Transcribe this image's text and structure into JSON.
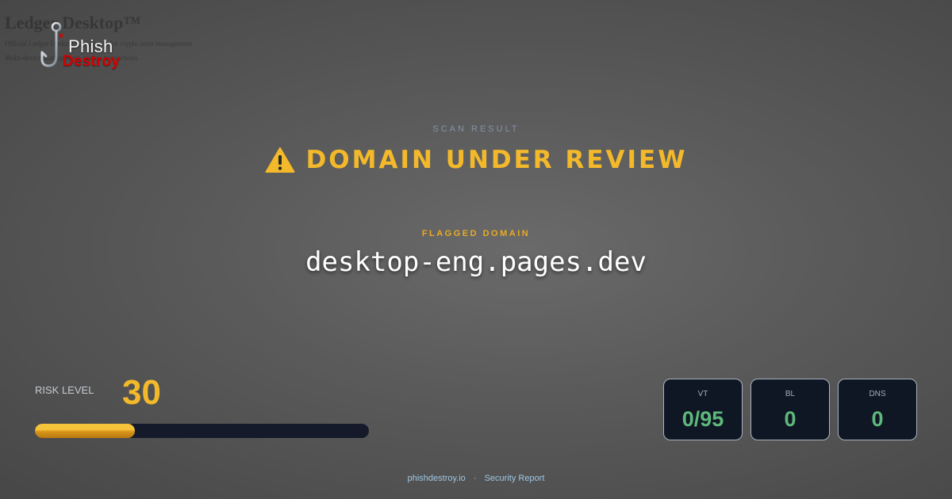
{
  "background_page": {
    "title": "Ledger Desktop™",
    "line1": "Official Ledger Desktop application for crypto asset management",
    "line2": "Multi-device management, secure transactions"
  },
  "logo": {
    "word1": "Phish",
    "word2": "Destroy",
    "icon": "fish-hook-icon"
  },
  "scan": {
    "label": "SCAN RESULT",
    "status_icon": "warning-triangle-icon",
    "status_text": "DOMAIN UNDER REVIEW"
  },
  "flagged": {
    "label": "FLAGGED DOMAIN",
    "domain": "desktop-eng.pages.dev"
  },
  "risk": {
    "label": "RISK LEVEL",
    "value": "30",
    "level": 30,
    "max": 100
  },
  "stats": [
    {
      "label": "VT",
      "value": "0/95"
    },
    {
      "label": "BL",
      "value": "0"
    },
    {
      "label": "DNS",
      "value": "0"
    }
  ],
  "footer": {
    "site": "phishdestroy.io",
    "separator": "·",
    "report": "Security Report"
  },
  "colors": {
    "accent": "#f3b92a",
    "domain_label": "#e8aa24",
    "stat_value": "#5fb87b",
    "brand_red": "#d40000",
    "card_bg": "#0f1624"
  }
}
